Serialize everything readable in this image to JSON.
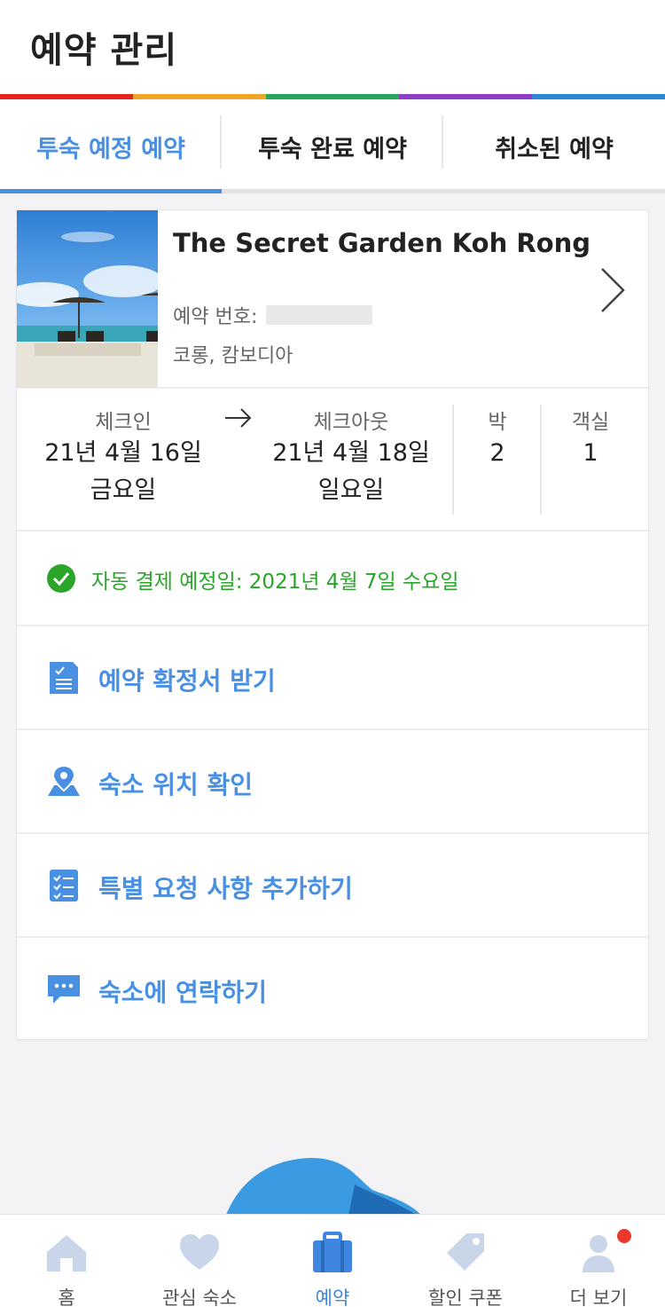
{
  "header": {
    "title": "예약 관리"
  },
  "rainbow_colors": [
    "#e52420",
    "#f0a524",
    "#2aa65a",
    "#8e3ec4",
    "#2a86d8"
  ],
  "tabs": [
    {
      "label": "투숙 예정 예약",
      "active": true
    },
    {
      "label": "투숙 완료 예약",
      "active": false
    },
    {
      "label": "취소된 예약",
      "active": false
    }
  ],
  "booking": {
    "hotel_name": "The Secret Garden Koh Rong",
    "reservation_label": "예약 번호:",
    "location": "코롱, 캄보디아",
    "checkin": {
      "label": "체크인",
      "date": "21년 4월 16일",
      "weekday": "금요일"
    },
    "checkout": {
      "label": "체크아웃",
      "date": "21년 4월 18일",
      "weekday": "일요일"
    },
    "nights": {
      "label": "박",
      "value": "2"
    },
    "rooms": {
      "label": "객실",
      "value": "1"
    },
    "auto_payment": "자동 결제 예정일: 2021년 4월 7일 수요일"
  },
  "actions": [
    {
      "label": "예약 확정서 받기",
      "icon": "document-icon"
    },
    {
      "label": "숙소 위치 확인",
      "icon": "map-pin-icon"
    },
    {
      "label": "특별 요청 사항 추가하기",
      "icon": "checklist-icon"
    },
    {
      "label": "숙소에 연락하기",
      "icon": "chat-icon"
    }
  ],
  "bottom_nav": [
    {
      "label": "홈",
      "icon": "home-icon",
      "active": false
    },
    {
      "label": "관심 숙소",
      "icon": "heart-icon",
      "active": false
    },
    {
      "label": "예약",
      "icon": "suitcase-icon",
      "active": true
    },
    {
      "label": "할인 쿠폰",
      "icon": "tag-icon",
      "active": false
    },
    {
      "label": "더 보기",
      "icon": "profile-icon",
      "active": false
    }
  ],
  "colors": {
    "accent": "#4a90e2",
    "success": "#2aa52a",
    "notification": "#e8392c"
  }
}
